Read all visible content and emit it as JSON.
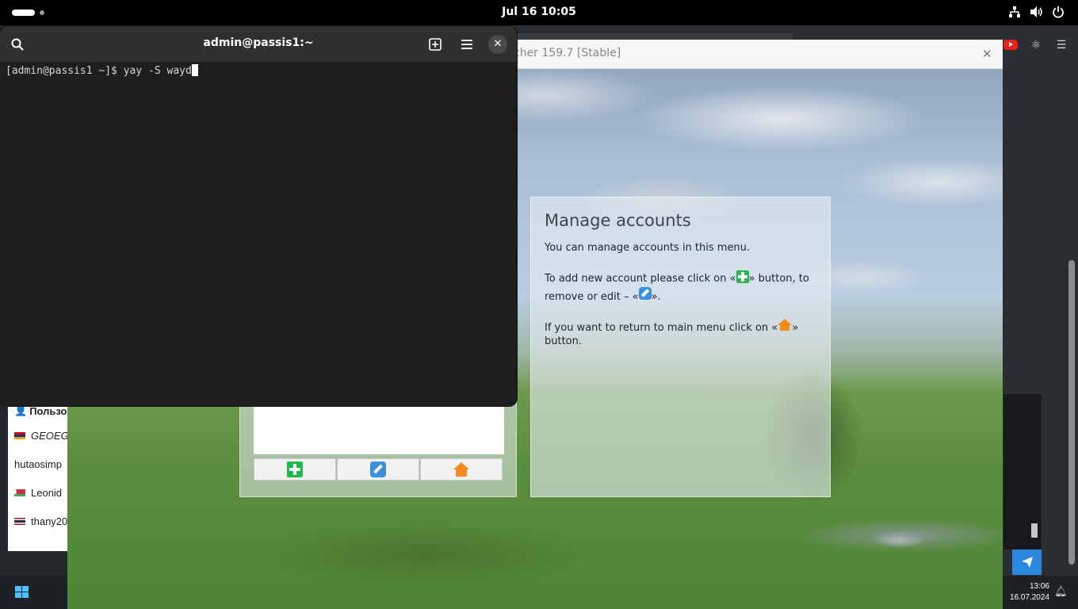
{
  "topbar": {
    "clock": "Jul 16  10:05"
  },
  "terminal": {
    "title": "admin@passis1:~",
    "prompt": "[admin@passis1 ~]$ ",
    "command": "yay -S wayd"
  },
  "launcher": {
    "title": "cher 159.7 [Stable]",
    "help": {
      "title": "Manage accounts",
      "line1": "You can manage accounts in this menu.",
      "line2_a": "To add new account please click on «",
      "line2_b": "» button, to",
      "line2_c": "remove or edit – «",
      "line2_d": "».",
      "line3_a": "If you want to return to main menu click on «",
      "line3_b": "»",
      "line3_c": "button."
    }
  },
  "chat_list": {
    "header": "Пользо",
    "items": [
      {
        "label": "GEOEG",
        "flag": "am",
        "italic": true
      },
      {
        "label": "hutaosimp",
        "flag": "",
        "italic": false
      },
      {
        "label": "Leonid",
        "flag": "by",
        "italic": false
      },
      {
        "label": "thany20",
        "flag": "th",
        "italic": false
      }
    ]
  },
  "taskbar": {
    "time": "13:06",
    "date": "16.07.2024"
  },
  "colors": {
    "topbar": "#000000",
    "terminal_bg": "#1e1e1e",
    "terminal_header": "#303030",
    "add_green": "#1fb84b",
    "edit_blue": "#3b8fdd",
    "home_orange": "#f28a1e",
    "send_blue": "#2a88e0"
  }
}
